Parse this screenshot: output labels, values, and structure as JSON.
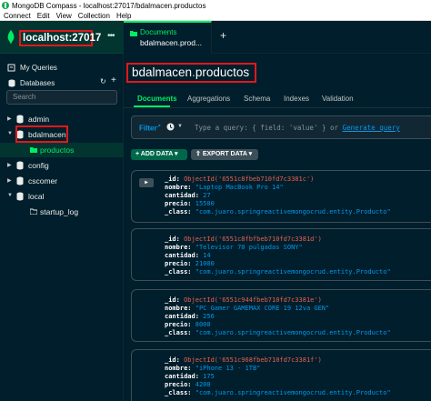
{
  "window": {
    "title": "MongoDB Compass - localhost:27017/bdalmacen.productos"
  },
  "menu": [
    "Connect",
    "Edit",
    "View",
    "Collection",
    "Help"
  ],
  "sidebar": {
    "connection": "localhost:27017",
    "more": "•••",
    "my_queries": "My Queries",
    "databases": "Databases",
    "search_placeholder": "Search",
    "dbs": [
      {
        "name": "admin"
      },
      {
        "name": "bdalmacen"
      },
      {
        "name": "config"
      },
      {
        "name": "cscomer"
      },
      {
        "name": "local"
      }
    ],
    "collections": {
      "bdalmacen": "productos",
      "local": "startup_log"
    }
  },
  "tabs": [
    {
      "label": "Documents",
      "sublabel": "bdalmacen.prod..."
    }
  ],
  "main": {
    "db": "bdalmacen",
    "coll": "productos",
    "subtabs": [
      "Documents",
      "Aggregations",
      "Schema",
      "Indexes",
      "Validation"
    ],
    "filter_label": "Filter",
    "query_placeholder": "Type a query: { field: 'value' } or ",
    "generate_query": "Generate query",
    "add_data": "ADD DATA",
    "export_data": "EXPORT DATA"
  },
  "documents": [
    {
      "id": "ObjectId('6551c8fbeb710fd7c3381c')",
      "nombre": "\"Laptop MacBook Pro 14\"",
      "cantidad": "27",
      "precio": "15500",
      "class": "\"com.juaro.springreactivemongocrud.entity.Producto\""
    },
    {
      "id": "ObjectId('6551c8fbfbeb710fd7c3381d')",
      "nombre": "\"Televisor 70 pulgadas SONY\"",
      "cantidad": "14",
      "precio": "21000",
      "class": "\"com.juaro.springreactivemongocrud.entity.Producto\""
    },
    {
      "id": "ObjectId('6551c944fbeb710fd7c3381e')",
      "nombre": "\"PC Gamer GAMEMAX CORE 19 12va GEN\"",
      "cantidad": "256",
      "precio": "8000",
      "class": "\"com.juaro.springreactivemongocrud.entity.Producto\""
    },
    {
      "id": "ObjectId('6551c968fbeb710fd7c3381f')",
      "nombre": "\"iPhone 13 - 1TB\"",
      "cantidad": "175",
      "precio": "4200",
      "class": "\"com.juaro.springreactivemongocrud.entity.Producto\""
    }
  ],
  "field_labels": {
    "id": "_id:",
    "nombre": "nombre:",
    "cantidad": "cantidad:",
    "precio": "precio:",
    "class": "_class:"
  }
}
